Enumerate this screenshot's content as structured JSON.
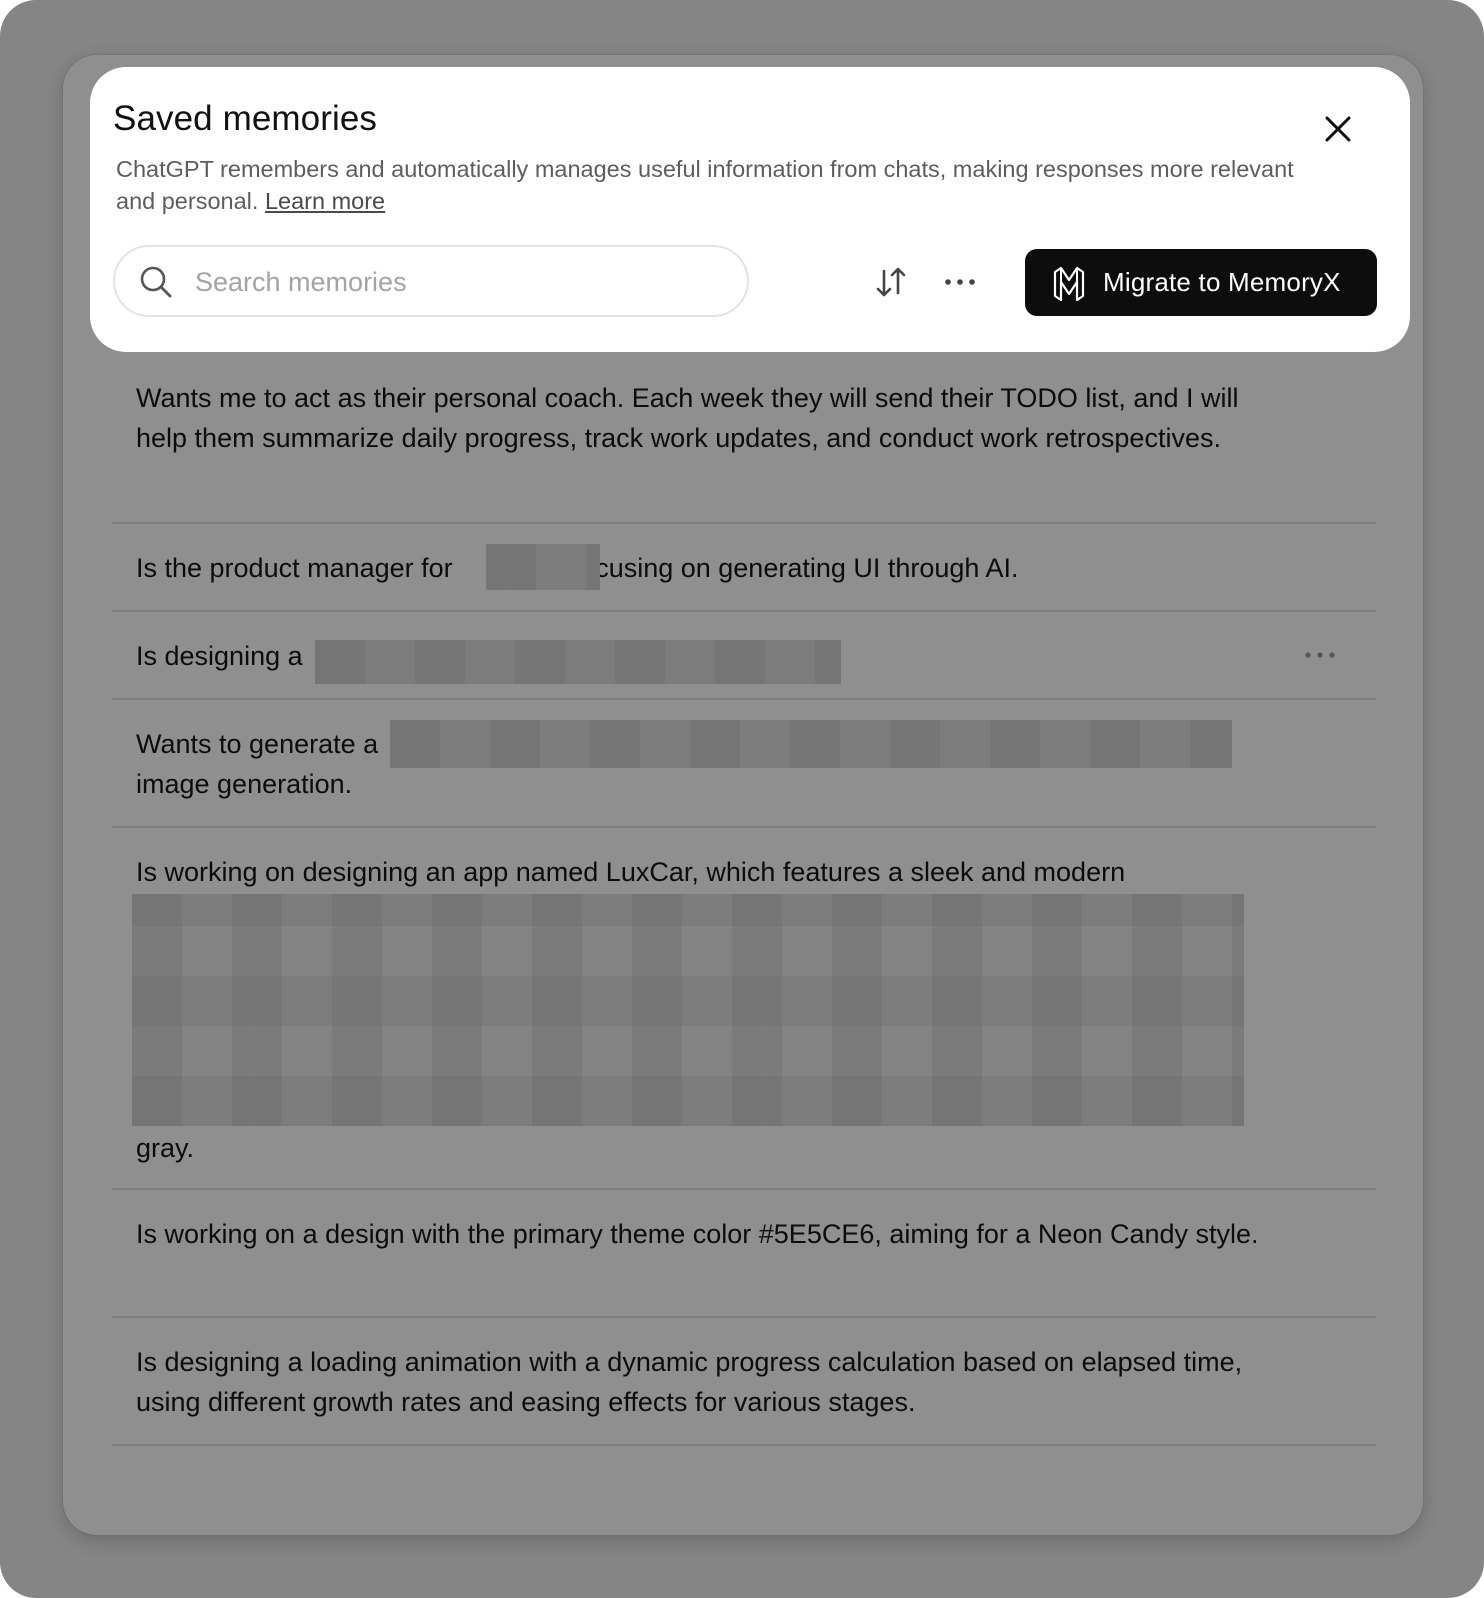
{
  "header": {
    "title": "Saved memories",
    "description": "ChatGPT remembers and automatically manages useful information from chats, making responses more relevant and personal.",
    "learn_more": "Learn more"
  },
  "search": {
    "placeholder": "Search memories",
    "value": ""
  },
  "toolbar": {
    "sort_icon": "sort-arrows-icon",
    "more_icon": "ellipsis-icon",
    "migrate_label": "Migrate to MemoryX",
    "migrate_icon": "memoryx-logo-icon"
  },
  "memories": [
    {
      "text": "Wants me to act as their personal coach. Each week they will send their TODO list, and I will help them summarize daily progress, track work updates, and conduct work retrospectives."
    },
    {
      "text": "Is the product manager for",
      "text_after": "focusing on generating UI through AI.",
      "redacted": true
    },
    {
      "text": "Is designing a",
      "redacted": true
    },
    {
      "text": "Wants to generate a",
      "text_after": "image generation.",
      "redacted": true
    },
    {
      "text": "Is working on designing an app named LuxCar, which features a sleek and modern",
      "text_after": "gray.",
      "redacted": true
    },
    {
      "text": "Is working on a design with the primary theme color #5E5CE6, aiming for a Neon Candy style."
    },
    {
      "text": "Is designing a loading animation with a dynamic progress calculation based on elapsed time, using different growth rates and easing effects for various stages."
    }
  ],
  "colors": {
    "backdrop": "#858585",
    "dialog": "#8f8f8f",
    "header_bg": "#ffffff",
    "migrate_bg": "#0d0d0d",
    "redaction": "#838383"
  }
}
